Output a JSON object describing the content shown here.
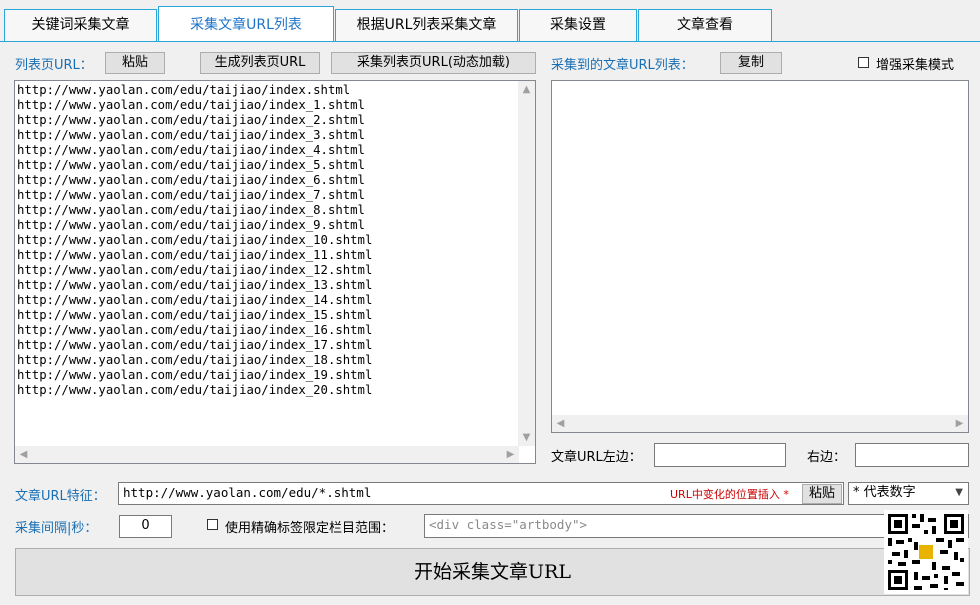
{
  "tabs": [
    {
      "label": "关键词采集文章"
    },
    {
      "label": "采集文章URL列表"
    },
    {
      "label": "根据URL列表采集文章"
    },
    {
      "label": "采集设置"
    },
    {
      "label": "文章查看"
    }
  ],
  "left_panel": {
    "label": "列表页URL：",
    "paste_button": "粘贴",
    "generate_button": "生成列表页URL",
    "collect_button": "采集列表页URL(动态加载)",
    "urls": [
      "http://www.yaolan.com/edu/taijiao/index.shtml",
      "http://www.yaolan.com/edu/taijiao/index_1.shtml",
      "http://www.yaolan.com/edu/taijiao/index_2.shtml",
      "http://www.yaolan.com/edu/taijiao/index_3.shtml",
      "http://www.yaolan.com/edu/taijiao/index_4.shtml",
      "http://www.yaolan.com/edu/taijiao/index_5.shtml",
      "http://www.yaolan.com/edu/taijiao/index_6.shtml",
      "http://www.yaolan.com/edu/taijiao/index_7.shtml",
      "http://www.yaolan.com/edu/taijiao/index_8.shtml",
      "http://www.yaolan.com/edu/taijiao/index_9.shtml",
      "http://www.yaolan.com/edu/taijiao/index_10.shtml",
      "http://www.yaolan.com/edu/taijiao/index_11.shtml",
      "http://www.yaolan.com/edu/taijiao/index_12.shtml",
      "http://www.yaolan.com/edu/taijiao/index_13.shtml",
      "http://www.yaolan.com/edu/taijiao/index_14.shtml",
      "http://www.yaolan.com/edu/taijiao/index_15.shtml",
      "http://www.yaolan.com/edu/taijiao/index_16.shtml",
      "http://www.yaolan.com/edu/taijiao/index_17.shtml",
      "http://www.yaolan.com/edu/taijiao/index_18.shtml",
      "http://www.yaolan.com/edu/taijiao/index_19.shtml",
      "http://www.yaolan.com/edu/taijiao/index_20.shtml"
    ]
  },
  "right_panel": {
    "label": "采集到的文章URL列表：",
    "copy_button": "复制",
    "enhanced_mode_label": "增强采集模式",
    "left_edge_label": "文章URL左边：",
    "right_edge_label": "右边："
  },
  "feature": {
    "label": "文章URL特征：",
    "value": "http://www.yaolan.com/edu/*.shtml",
    "hint": "URL中变化的位置插入 *",
    "paste_button": "粘贴",
    "select_value": "* 代表数字"
  },
  "interval": {
    "label": "采集间隔|秒：",
    "value": "0",
    "precise_label": "使用精确标签限定栏目范围：",
    "precise_value": "<div class=\"artbody\">"
  },
  "start_button": "开始采集文章URL",
  "colors": {
    "accent": "#1e73c8",
    "tab_border": "#2aa7d8",
    "hint_red": "#cc0000"
  }
}
